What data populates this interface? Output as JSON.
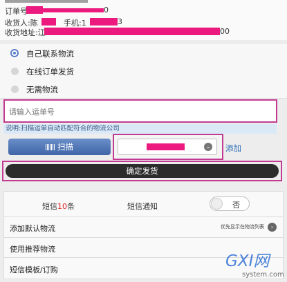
{
  "order": {
    "number_label": "订单号:",
    "number_suffix": "0",
    "receiver_label": "收货人:陈",
    "phone_label": "手机:1",
    "phone_suffix": "3",
    "address_label": "收货地址:江",
    "address_suffix": "00"
  },
  "shipping_options": [
    {
      "label": "自己联系物流",
      "selected": true
    },
    {
      "label": "在线订单发货",
      "selected": false
    },
    {
      "label": "无需物流",
      "selected": false
    }
  ],
  "tracking": {
    "placeholder": "请输入运单号",
    "note": "说明:扫描运单自动匹配符合的物流公司"
  },
  "actions": {
    "scan_label": "扫描",
    "add_label": "添加",
    "confirm_label": "确定发货",
    "chevron_glyph": "⌄"
  },
  "settings": {
    "sms_prefix": "短信",
    "sms_count": "10",
    "sms_suffix": "条",
    "notify_label": "短信通知",
    "toggle_label": "否",
    "default_logistics_label": "添加默认物流",
    "default_logistics_hint": "优先显示在物流列表",
    "recommended_label": "使用推荐物流",
    "template_label": "短信模板/订购",
    "go_glyph": "›"
  },
  "watermark": {
    "brand": "GXI网",
    "domain": "system.com"
  },
  "colors": {
    "redaction": "#ec1a7e",
    "highlight_frame": "#c23a91",
    "accent": "#5b7fc9",
    "sms_count": "#e01e1e"
  }
}
